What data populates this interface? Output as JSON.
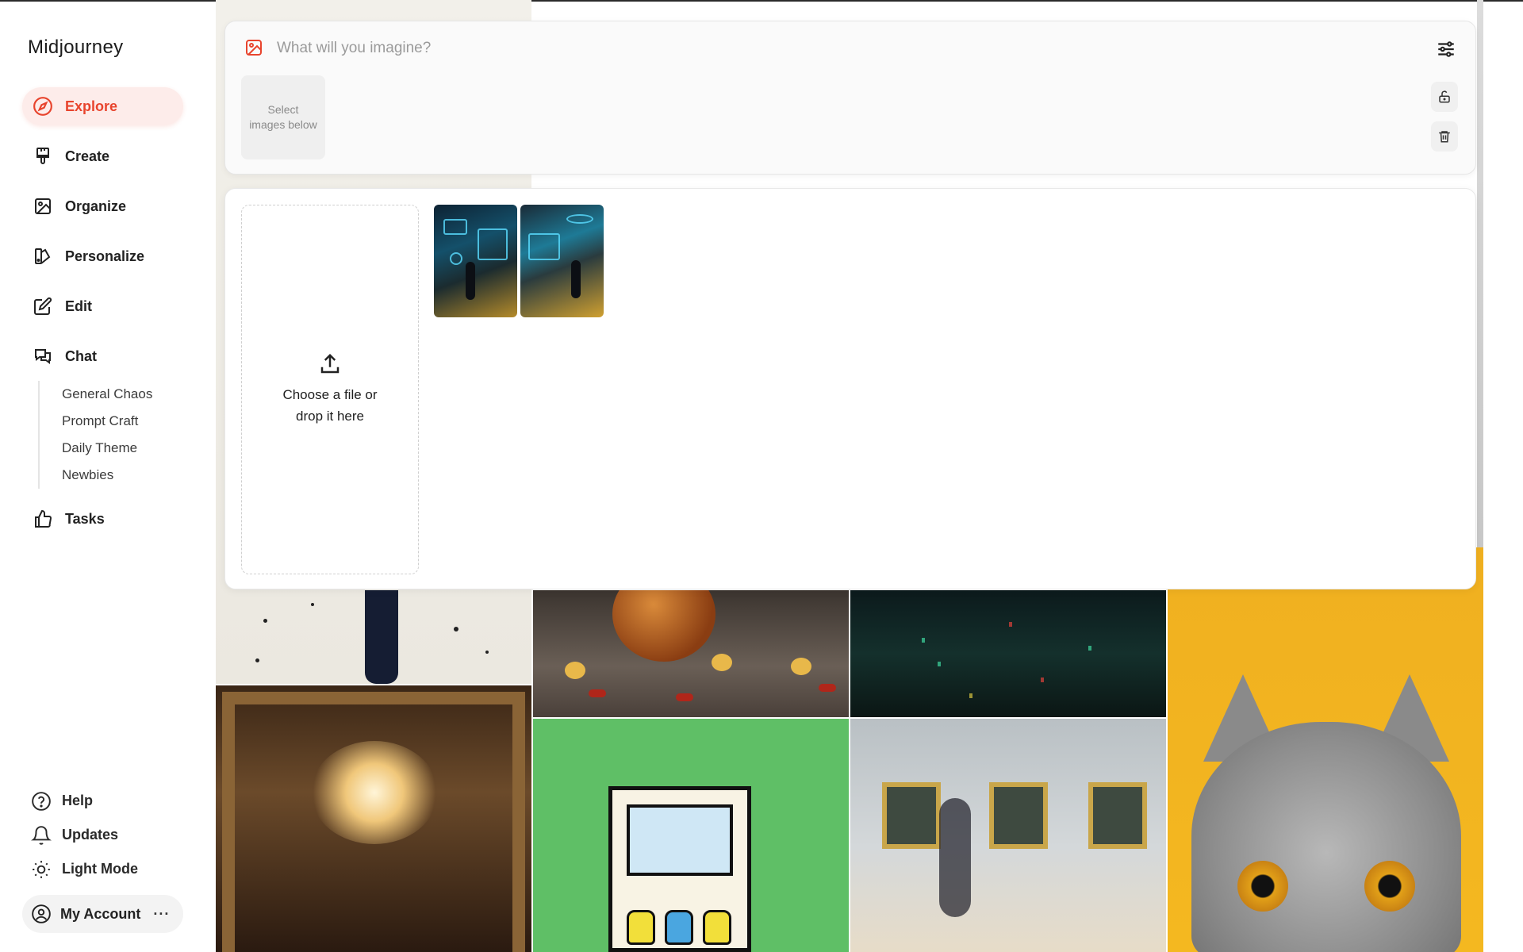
{
  "app": {
    "brand": "Midjourney"
  },
  "sidebar": {
    "items": [
      {
        "label": "Explore",
        "icon": "compass-icon",
        "active": true
      },
      {
        "label": "Create",
        "icon": "paintbrush-icon",
        "active": false
      },
      {
        "label": "Organize",
        "icon": "image-icon",
        "active": false
      },
      {
        "label": "Personalize",
        "icon": "swatch-icon",
        "active": false
      },
      {
        "label": "Edit",
        "icon": "edit-icon",
        "active": false
      },
      {
        "label": "Chat",
        "icon": "chat-icon",
        "active": false
      },
      {
        "label": "Tasks",
        "icon": "thumbs-up-icon",
        "active": false
      }
    ],
    "chat_channels": [
      "General Chaos",
      "Prompt Craft",
      "Daily Theme",
      "Newbies"
    ],
    "bottom": [
      {
        "label": "Help",
        "icon": "help-icon"
      },
      {
        "label": "Updates",
        "icon": "bell-icon"
      },
      {
        "label": "Light Mode",
        "icon": "sun-icon"
      }
    ],
    "account": {
      "label": "My Account",
      "more": "···"
    }
  },
  "prompt": {
    "placeholder": "What will you imagine?",
    "value": "",
    "select_hint": "Select images below"
  },
  "upload": {
    "dropzone_text": "Choose a file or drop it here",
    "thumbnail_count": 2
  },
  "colors": {
    "accent": "#e8442d",
    "accent_bg": "#fdecea",
    "text": "#1f1f1f",
    "muted": "#9a9a9a"
  }
}
